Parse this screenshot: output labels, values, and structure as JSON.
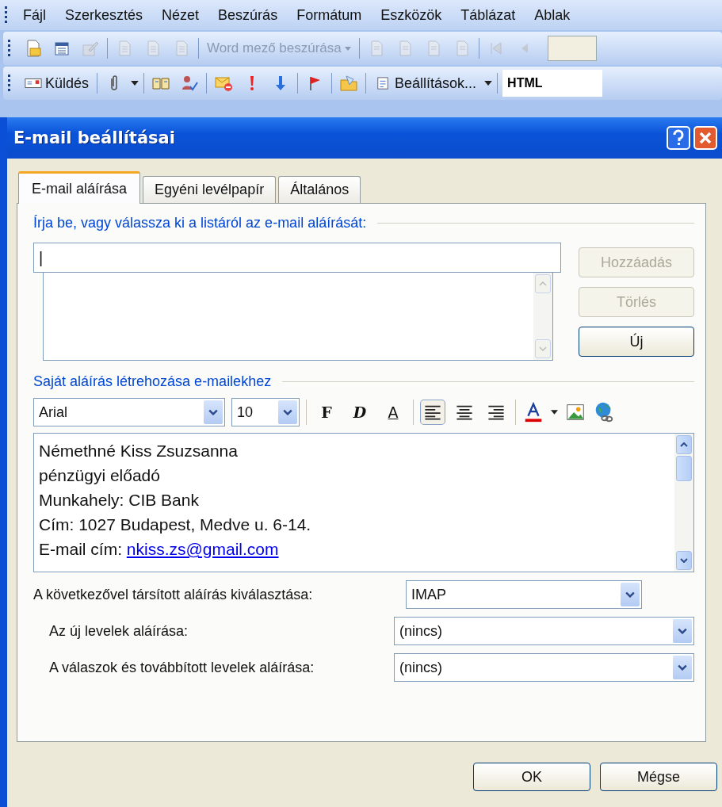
{
  "menu": [
    "Fájl",
    "Szerkesztés",
    "Nézet",
    "Beszúrás",
    "Formátum",
    "Eszközök",
    "Táblázat",
    "Ablak"
  ],
  "toolbar_1": {
    "field_dropdown": {
      "label": "Word mező beszúrása",
      "disabled": true
    }
  },
  "toolbar_2": {
    "send_button": "Küldés",
    "options_button": "Beállítások...",
    "format_field": "HTML"
  },
  "dialog": {
    "title": "E-mail beállításai",
    "tabs": [
      {
        "label": "E-mail aláírása",
        "selected": true
      },
      {
        "label": "Egyéni levélpapír",
        "selected": false
      },
      {
        "label": "Általános",
        "selected": false
      }
    ],
    "signature_list": {
      "heading": "Írja be, vagy válassza ki a listáról az e-mail aláírását:",
      "name_field": {
        "value": "|"
      }
    },
    "side_buttons": [
      {
        "label": "Hozzáadás",
        "disabled": true
      },
      {
        "label": "Törlés",
        "disabled": true
      },
      {
        "label": "Új",
        "disabled": false
      }
    ],
    "editor": {
      "heading": "Saját aláírás létrehozása e-mailekhez",
      "font": "Arial",
      "size": "10",
      "format_buttons": [
        {
          "label": "F",
          "kind": "bold"
        },
        {
          "label": "D",
          "kind": "italic"
        },
        {
          "label": "A",
          "kind": "underline"
        }
      ],
      "alignments": [
        {
          "kind": "left",
          "selected": true
        },
        {
          "kind": "center",
          "selected": false
        },
        {
          "kind": "right",
          "selected": false
        }
      ],
      "lines": [
        {
          "text": "Némethné Kiss Zsuzsanna"
        },
        {
          "text": "pénzügyi előadó"
        },
        {
          "text": "Munkahely: CIB Bank"
        },
        {
          "text": "Cím: 1027 Budapest, Medve u. 6-14."
        },
        {
          "text": "E-mail cím: ",
          "link": "nkiss.zs@gmail.com"
        }
      ]
    },
    "selects": [
      {
        "label": "A következővel társított aláírás kiválasztása:",
        "value": "IMAP",
        "indent": false
      },
      {
        "label": "Az új levelek aláírása:",
        "value": "(nincs)",
        "indent": true
      },
      {
        "label": "A válaszok és továbbított levelek aláírása:",
        "value": "(nincs)",
        "indent": true
      }
    ],
    "buttons": [
      "OK",
      "Mégse"
    ]
  }
}
